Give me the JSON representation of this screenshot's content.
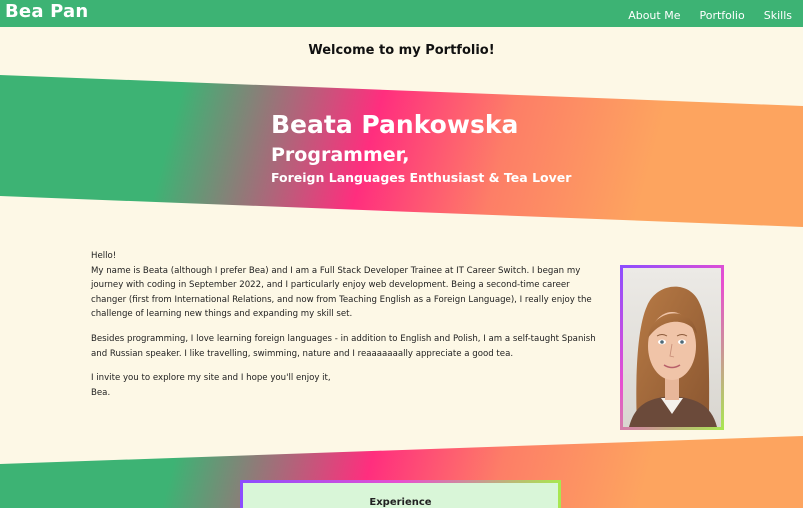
{
  "nav": {
    "brand": "Bea Pan",
    "links": [
      "About Me",
      "Portfolio",
      "Skills"
    ]
  },
  "welcome": "Welcome to my Portfolio!",
  "hero": {
    "name": "Beata Pankowska",
    "role": "Programmer,",
    "interests": "Foreign Languages Enthusiast & Tea Lover"
  },
  "about": {
    "greeting": "Hello!",
    "paragraph1": "My name is Beata (although I prefer Bea) and I am a Full Stack Developer Trainee at IT Career Switch. I began my journey with coding in September 2022, and I particularly enjoy web development. Being a second-time career changer (first from International Relations, and now from Teaching English as a Foreign Language), I really enjoy the challenge of learning new things and expanding my skill set.",
    "paragraph2": "Besides programming, I love learning foreign languages - in addition to English and Polish, I am a self-taught Spanish and Russian speaker. I like travelling, swimming, nature and I reaaaaaaally appreciate a good tea.",
    "paragraph3_line1": "I invite you to explore my site and I hope you'll enjoy it,",
    "paragraph3_line2": "Bea."
  },
  "experience": {
    "title": "Experience"
  },
  "colors": {
    "accent": "#3db374",
    "pink": "#ff2e7e",
    "orange": "#fda45f",
    "background": "#fdf8e6"
  }
}
